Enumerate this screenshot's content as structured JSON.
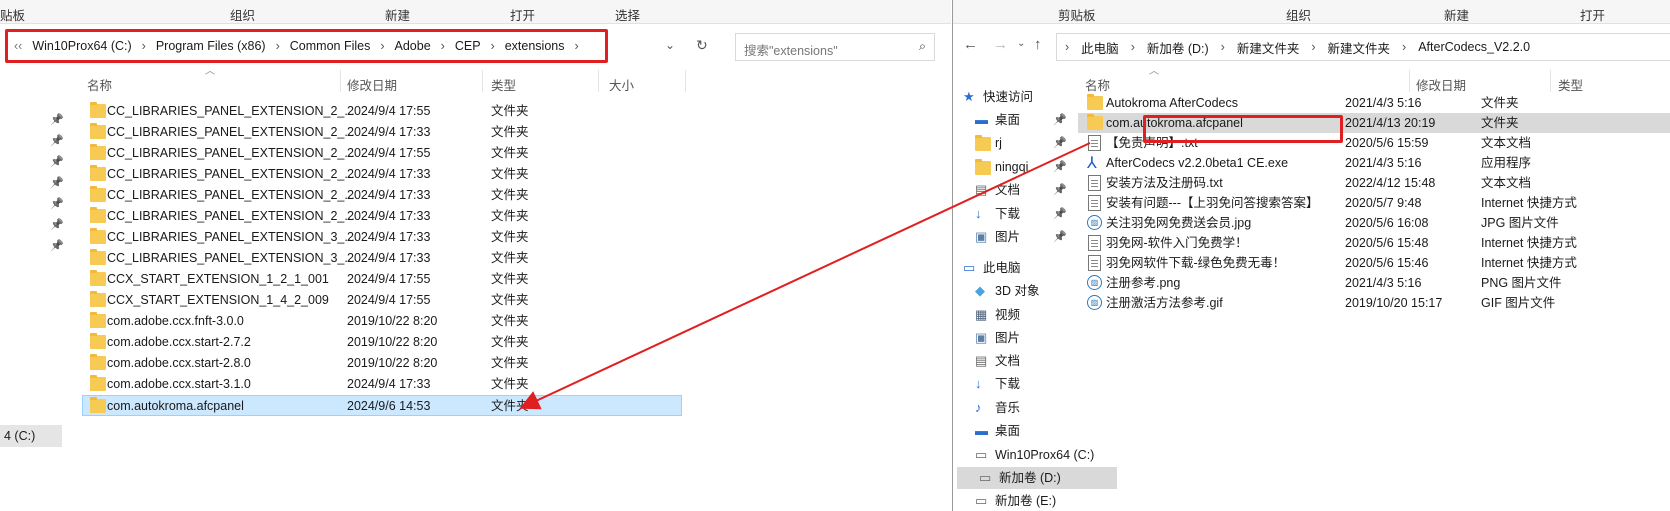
{
  "left": {
    "ribbon": {
      "t1": "贴板",
      "t2": "组织",
      "t3": "新建",
      "t4": "打开",
      "t5": "选择"
    },
    "breadcrumb": {
      "prefix": "‹‹",
      "items": [
        "Win10Prox64 (C:)",
        "Program Files (x86)",
        "Common Files",
        "Adobe",
        "CEP",
        "extensions"
      ]
    },
    "search": {
      "placeholder": "搜索\"extensions\""
    },
    "columns": {
      "name": "名称",
      "date": "修改日期",
      "type": "类型",
      "size": "大小"
    },
    "rows": [
      {
        "name": "CC_LIBRARIES_PANEL_EXTENSION_2_...",
        "date": "2024/9/4 17:55",
        "type": "文件夹"
      },
      {
        "name": "CC_LIBRARIES_PANEL_EXTENSION_2_...",
        "date": "2024/9/4 17:33",
        "type": "文件夹"
      },
      {
        "name": "CC_LIBRARIES_PANEL_EXTENSION_2_...",
        "date": "2024/9/4 17:55",
        "type": "文件夹"
      },
      {
        "name": "CC_LIBRARIES_PANEL_EXTENSION_2_...",
        "date": "2024/9/4 17:33",
        "type": "文件夹"
      },
      {
        "name": "CC_LIBRARIES_PANEL_EXTENSION_2_...",
        "date": "2024/9/4 17:33",
        "type": "文件夹"
      },
      {
        "name": "CC_LIBRARIES_PANEL_EXTENSION_2_...",
        "date": "2024/9/4 17:33",
        "type": "文件夹"
      },
      {
        "name": "CC_LIBRARIES_PANEL_EXTENSION_3_...",
        "date": "2024/9/4 17:33",
        "type": "文件夹"
      },
      {
        "name": "CC_LIBRARIES_PANEL_EXTENSION_3_...",
        "date": "2024/9/4 17:33",
        "type": "文件夹"
      },
      {
        "name": "CCX_START_EXTENSION_1_2_1_001",
        "date": "2024/9/4 17:55",
        "type": "文件夹"
      },
      {
        "name": "CCX_START_EXTENSION_1_4_2_009",
        "date": "2024/9/4 17:55",
        "type": "文件夹"
      },
      {
        "name": "com.adobe.ccx.fnft-3.0.0",
        "date": "2019/10/22 8:20",
        "type": "文件夹"
      },
      {
        "name": "com.adobe.ccx.start-2.7.2",
        "date": "2019/10/22 8:20",
        "type": "文件夹"
      },
      {
        "name": "com.adobe.ccx.start-2.8.0",
        "date": "2019/10/22 8:20",
        "type": "文件夹"
      },
      {
        "name": "com.adobe.ccx.start-3.1.0",
        "date": "2024/9/4 17:33",
        "type": "文件夹"
      },
      {
        "name": "com.autokroma.afcpanel",
        "date": "2024/9/6 14:53",
        "type": "文件夹"
      }
    ],
    "drive_label": "4 (C:)"
  },
  "right": {
    "ribbon": {
      "t1": "剪贴板",
      "t2": "组织",
      "t3": "新建",
      "t4": "打开"
    },
    "breadcrumb": {
      "items": [
        "此电脑",
        "新加卷 (D:)",
        "新建文件夹",
        "新建文件夹",
        "AfterCodecs_V2.2.0"
      ]
    },
    "columns": {
      "name": "名称",
      "date": "修改日期",
      "type": "类型"
    },
    "nav": [
      {
        "label": "快速访问",
        "icon": "star-icon"
      },
      {
        "label": "桌面",
        "icon": "desktop-icon"
      },
      {
        "label": "rj",
        "icon": "folder-icon"
      },
      {
        "label": "ningqi",
        "icon": "folder-icon"
      },
      {
        "label": "文档",
        "icon": "document-icon"
      },
      {
        "label": "下载",
        "icon": "download-icon"
      },
      {
        "label": "图片",
        "icon": "picture-icon"
      },
      {
        "label": "此电脑",
        "icon": "computer-icon"
      },
      {
        "label": "3D 对象",
        "icon": "cube-icon"
      },
      {
        "label": "视频",
        "icon": "video-icon"
      },
      {
        "label": "图片",
        "icon": "picture-icon"
      },
      {
        "label": "文档",
        "icon": "document-icon"
      },
      {
        "label": "下载",
        "icon": "download-icon"
      },
      {
        "label": "音乐",
        "icon": "music-icon"
      },
      {
        "label": "桌面",
        "icon": "desktop-icon"
      },
      {
        "label": "Win10Prox64 (C:)",
        "icon": "drive-icon"
      },
      {
        "label": "新加卷 (D:)",
        "icon": "drive-icon"
      },
      {
        "label": "新加卷 (E:)",
        "icon": "drive-icon"
      }
    ],
    "rows": [
      {
        "name": "Autokroma AfterCodecs",
        "date": "2021/4/3 5:16",
        "type": "文件夹",
        "icon": "folder"
      },
      {
        "name": "com.autokroma.afcpanel",
        "date": "2021/4/13 20:19",
        "type": "文件夹",
        "icon": "folder"
      },
      {
        "name": "【免责声明】.txt",
        "date": "2020/5/6 15:59",
        "type": "文本文档",
        "icon": "file"
      },
      {
        "name": "AfterCodecs v2.2.0beta1 CE.exe",
        "date": "2021/4/3 5:16",
        "type": "应用程序",
        "icon": "exe"
      },
      {
        "name": "安装方法及注册码.txt",
        "date": "2022/4/12 15:48",
        "type": "文本文档",
        "icon": "file"
      },
      {
        "name": "安装有问题---【上羽免问答搜索答案】",
        "date": "2020/5/7 9:48",
        "type": "Internet 快捷方式",
        "icon": "file"
      },
      {
        "name": "关注羽免网免费送会员.jpg",
        "date": "2020/5/6 16:08",
        "type": "JPG 图片文件",
        "icon": "img"
      },
      {
        "name": "羽免网-软件入门免费学！",
        "date": "2020/5/6 15:48",
        "type": "Internet 快捷方式",
        "icon": "file"
      },
      {
        "name": "羽免网软件下载-绿色免费无毒！",
        "date": "2020/5/6 15:46",
        "type": "Internet 快捷方式",
        "icon": "file"
      },
      {
        "name": "注册参考.png",
        "date": "2021/4/3 5:16",
        "type": "PNG 图片文件",
        "icon": "img"
      },
      {
        "name": "注册激活方法参考.gif",
        "date": "2019/10/20 15:17",
        "type": "GIF 图片文件",
        "icon": "img"
      }
    ]
  },
  "colors": {
    "highlight": "#e02020",
    "selection": "#cce8ff",
    "folder": "#f7ca54"
  }
}
